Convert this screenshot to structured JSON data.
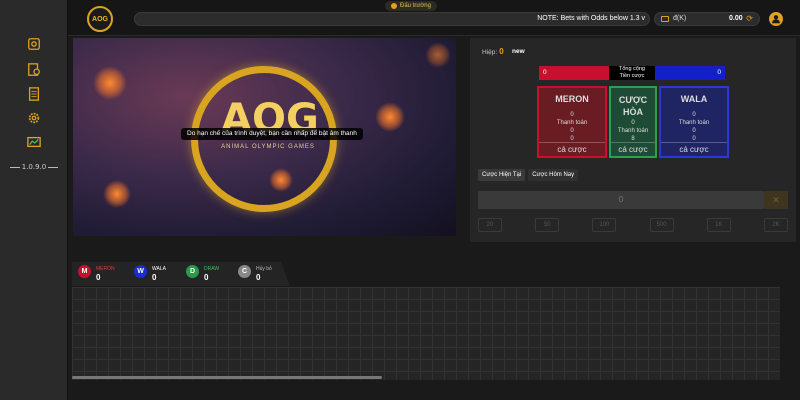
{
  "app": {
    "version": "1.0.9.0",
    "logo_text": "AOG"
  },
  "sidebar": {
    "icons": [
      "cashier-icon",
      "wallet-icon",
      "document-icon",
      "gear-icon",
      "dashboard-icon"
    ]
  },
  "topbar": {
    "pill_label": "Đấu trường",
    "notice": "NOTE: Bets with Odds below 1.3 v",
    "currency": "đ(K)",
    "balance": "0.00"
  },
  "video": {
    "logo_text": "AOG",
    "logo_sub": "ANIMAL OLYMPIC GAMES",
    "toast": "Do hạn chế của trình duyệt, bạn cần nhấp để bật âm thanh"
  },
  "betting": {
    "round_label": "Hiệp:",
    "round_value": "0",
    "status": "new",
    "total_left": "0",
    "total_label_1": "Tổng cộng",
    "total_label_2": "Tiền cược",
    "total_right": "0",
    "meron": {
      "title": "MERON",
      "v1": "0",
      "pay_label": "Thanh toán",
      "v2": "0",
      "v3": "0",
      "bet_label": "cá cược"
    },
    "hoa": {
      "title": "CƯỢC HÒA",
      "v1": "0",
      "pay_label": "Thanh toán",
      "v2": "8",
      "bet_label": "cá cược"
    },
    "wala": {
      "title": "WALA",
      "v1": "0",
      "pay_label": "Thanh toán",
      "v2": "0",
      "v3": "0",
      "bet_label": "cá cược"
    },
    "tabs": [
      "Cược Hiện Tại",
      "Cược Hôm Nay"
    ],
    "amount": "0",
    "clear": "✕",
    "chips": [
      "20",
      "50",
      "100",
      "500",
      "1K",
      "2K"
    ]
  },
  "stats": [
    {
      "letter": "M",
      "label": "MERON",
      "value": "0",
      "color": "#c8102e",
      "label_color": "#e03a3a"
    },
    {
      "letter": "W",
      "label": "WALA",
      "value": "0",
      "color": "#1a2bd8",
      "label_color": "#ffffff"
    },
    {
      "letter": "D",
      "label": "DRAW",
      "value": "0",
      "color": "#2a9a4a",
      "label_color": "#3cc060"
    },
    {
      "letter": "C",
      "label": "Hủy bỏ",
      "value": "0",
      "color": "#888888",
      "label_color": "#bbbbbb"
    }
  ]
}
